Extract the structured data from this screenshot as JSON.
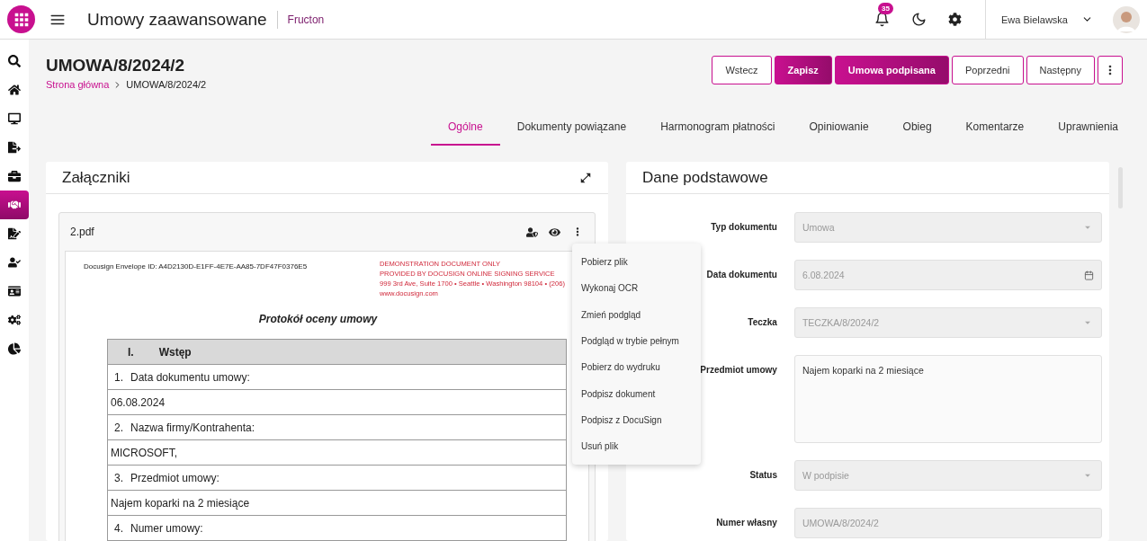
{
  "header": {
    "app_title": "Umowy zaawansowane",
    "company": "Fructon",
    "notification_count": "35",
    "user_name": "Ewa Bielawska"
  },
  "sidebar": {
    "items": [
      {
        "selected": false
      },
      {
        "selected": false
      },
      {
        "selected": false
      },
      {
        "selected": false
      },
      {
        "selected": false
      },
      {
        "selected": true
      },
      {
        "selected": false
      },
      {
        "selected": false
      },
      {
        "selected": false
      },
      {
        "selected": false
      },
      {
        "selected": false
      }
    ]
  },
  "page": {
    "title": "UMOWA/8/2024/2",
    "breadcrumb": [
      {
        "label": "Strona główna",
        "kind": "link"
      },
      {
        "label": "UMOWA/8/2024/2",
        "kind": "current"
      }
    ],
    "actions": [
      {
        "label": "Wstecz",
        "kind": "outline"
      },
      {
        "label": "Zapisz",
        "kind": "filled"
      },
      {
        "label": "Umowa podpisana",
        "kind": "filled"
      },
      {
        "label": "Poprzedni",
        "kind": "outline"
      },
      {
        "label": "Następny",
        "kind": "outline"
      },
      {
        "kind": "more"
      }
    ]
  },
  "tabs": [
    {
      "label": "Ogólne",
      "selected": true
    },
    {
      "label": "Dokumenty powiązane",
      "selected": false
    },
    {
      "label": "Harmonogram płatności",
      "selected": false
    },
    {
      "label": "Opiniowanie",
      "selected": false
    },
    {
      "label": "Obieg",
      "selected": false
    },
    {
      "label": "Komentarze",
      "selected": false
    },
    {
      "label": "Uprawnienia",
      "selected": false
    }
  ],
  "attachments": {
    "title": "Załączniki",
    "file": {
      "name": "2.pdf"
    },
    "document": {
      "envelope_id": "Docusign Envelope ID: A4D2130D-E1FF-4E7E-AA85-7DF47F0376E5",
      "notice": [
        "DEMONSTRATION DOCUMENT ONLY",
        "PROVIDED BY DOCUSIGN ONLINE SIGNING SERVICE",
        "999 3rd Ave, Suite 1700  • Seattle • Washington 98104 • (206)",
        "www.docusign.com"
      ],
      "heading": "Protokół oceny umowy",
      "section": {
        "number": "I.",
        "title": "Wstęp"
      },
      "rows": [
        {
          "number": "1.",
          "text": "Data dokumentu umowy:"
        },
        {
          "text": "06.08.2024"
        },
        {
          "number": "2.",
          "text": "Nazwa firmy/Kontrahenta:"
        },
        {
          "text": "MICROSOFT,"
        },
        {
          "number": "3.",
          "text": "Przedmiot umowy:"
        },
        {
          "text": "Najem koparki na 2 miesiące"
        },
        {
          "number": "4.",
          "text": "Numer umowy:"
        }
      ]
    },
    "menu": [
      "Pobierz plik",
      "Wykonaj OCR",
      "Zmień podgląd",
      "Podgląd w trybie pełnym",
      "Pobierz do wydruku",
      "Podpisz dokument",
      "Podpisz z DocuSign",
      "Usuń plik"
    ]
  },
  "details": {
    "title": "Dane podstawowe",
    "fields": [
      {
        "label": "Typ dokumentu",
        "kind": "select",
        "value": "Umowa"
      },
      {
        "label": "Data dokumentu",
        "kind": "date",
        "value": "6.08.2024"
      },
      {
        "label": "Teczka",
        "kind": "select",
        "value": "TECZKA/8/2024/2"
      },
      {
        "label": "Przedmiot umowy",
        "kind": "textarea",
        "value": "Najem koparki na 2 miesiące"
      },
      {
        "label": "Status",
        "kind": "select",
        "value": "W podpisie"
      },
      {
        "label": "Numer własny",
        "kind": "text",
        "value": "UMOWA/8/2024/2"
      }
    ]
  }
}
